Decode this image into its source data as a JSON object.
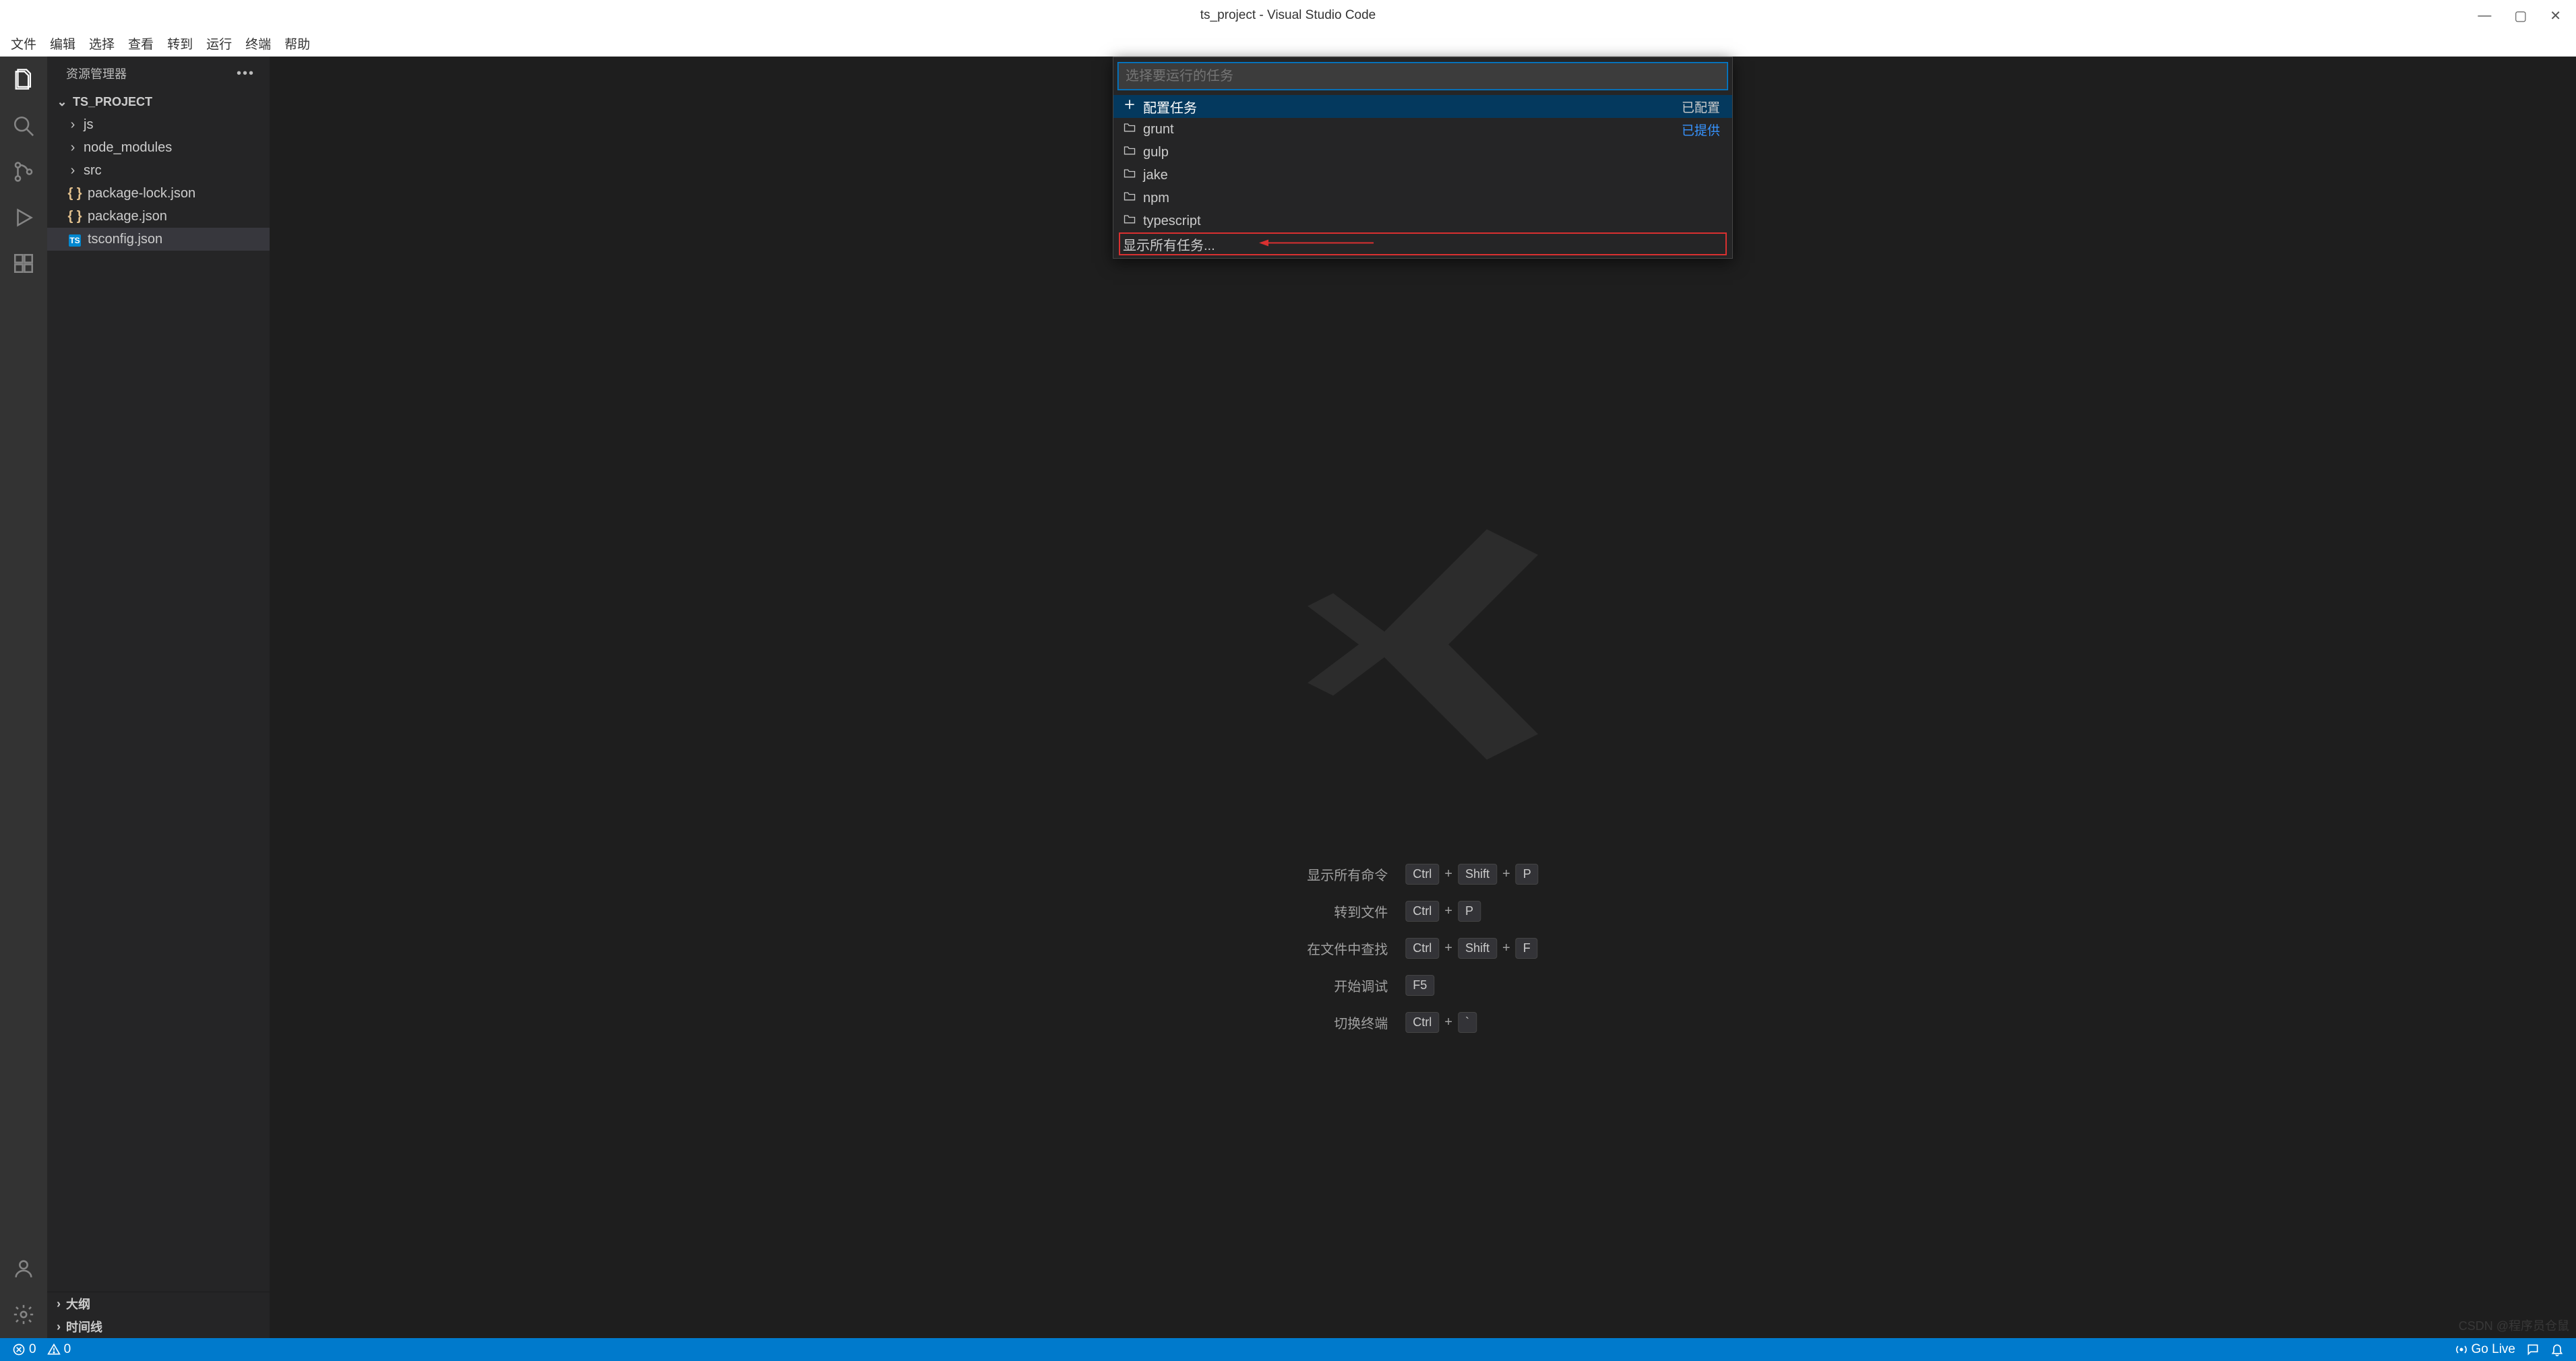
{
  "window": {
    "title": "ts_project - Visual Studio Code"
  },
  "menubar": [
    "文件",
    "编辑",
    "选择",
    "查看",
    "转到",
    "运行",
    "终端",
    "帮助"
  ],
  "explorer": {
    "title": "资源管理器",
    "root": "TS_PROJECT",
    "folders": [
      "js",
      "node_modules",
      "src"
    ],
    "files": [
      {
        "name": "package-lock.json",
        "icon": "json"
      },
      {
        "name": "package.json",
        "icon": "json"
      },
      {
        "name": "tsconfig.json",
        "icon": "ts",
        "selected": true
      }
    ],
    "sections": [
      "大纲",
      "时间线"
    ]
  },
  "quickpick": {
    "placeholder": "选择要运行的任务",
    "items": [
      {
        "icon": "plus",
        "label": "配置任务",
        "right": "已配置",
        "selected": true
      },
      {
        "icon": "folder",
        "label": "grunt",
        "right": "已提供",
        "rightClass": "link"
      },
      {
        "icon": "folder",
        "label": "gulp"
      },
      {
        "icon": "folder",
        "label": "jake"
      },
      {
        "icon": "folder",
        "label": "npm"
      },
      {
        "icon": "folder",
        "label": "typescript"
      },
      {
        "label": "显示所有任务...",
        "highlighted": true
      }
    ]
  },
  "shortcuts": [
    {
      "label": "显示所有命令",
      "keys": [
        "Ctrl",
        "Shift",
        "P"
      ]
    },
    {
      "label": "转到文件",
      "keys": [
        "Ctrl",
        "P"
      ]
    },
    {
      "label": "在文件中查找",
      "keys": [
        "Ctrl",
        "Shift",
        "F"
      ]
    },
    {
      "label": "开始调试",
      "keys": [
        "F5"
      ]
    },
    {
      "label": "切换终端",
      "keys": [
        "Ctrl",
        "`"
      ]
    }
  ],
  "statusbar": {
    "errors": "0",
    "warnings": "0",
    "golive": "Go Live"
  },
  "watermark": "CSDN @程序员仓鼠"
}
